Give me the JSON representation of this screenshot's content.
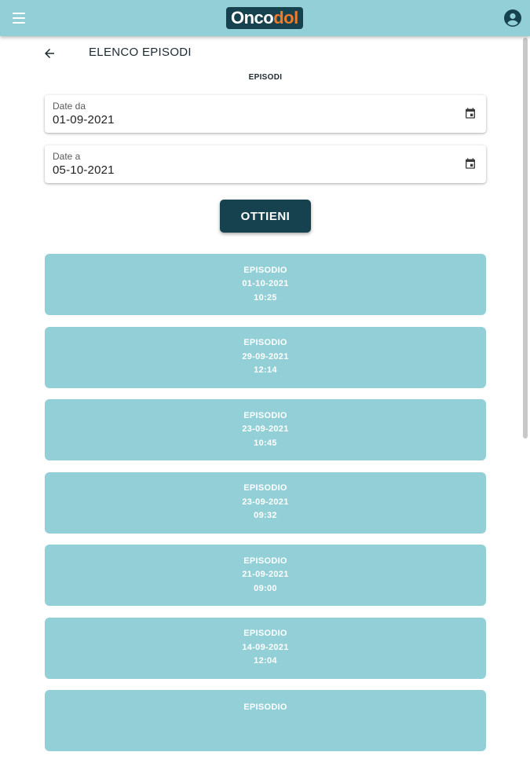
{
  "app": {
    "logo_part1": "Onco",
    "logo_part2": "dol",
    "colors": {
      "app_bar": "#93cfd6",
      "primary_dark": "#16414f",
      "logo_accent": "#f07c2a",
      "card": "#93cfd6"
    },
    "icons": {
      "menu": "menu-icon",
      "account": "account-circle-icon",
      "back": "arrow-left-icon",
      "calendar": "calendar-icon"
    }
  },
  "header": {
    "title": "ELENCO EPISODI",
    "section_label": "EPISODI"
  },
  "filters": {
    "date_from": {
      "label": "Date da",
      "value": "01-09-2021"
    },
    "date_to": {
      "label": "Date a",
      "value": "05-10-2021"
    },
    "submit_label": "OTTIENI"
  },
  "episodes": [
    {
      "title": "EPISODIO",
      "date": "01-10-2021",
      "time": "10:25"
    },
    {
      "title": "EPISODIO",
      "date": "29-09-2021",
      "time": "12:14"
    },
    {
      "title": "EPISODIO",
      "date": "23-09-2021",
      "time": "10:45"
    },
    {
      "title": "EPISODIO",
      "date": "23-09-2021",
      "time": "09:32"
    },
    {
      "title": "EPISODIO",
      "date": "21-09-2021",
      "time": "09:00"
    },
    {
      "title": "EPISODIO",
      "date": "14-09-2021",
      "time": "12:04"
    },
    {
      "title": "EPISODIO",
      "date": "",
      "time": ""
    }
  ]
}
